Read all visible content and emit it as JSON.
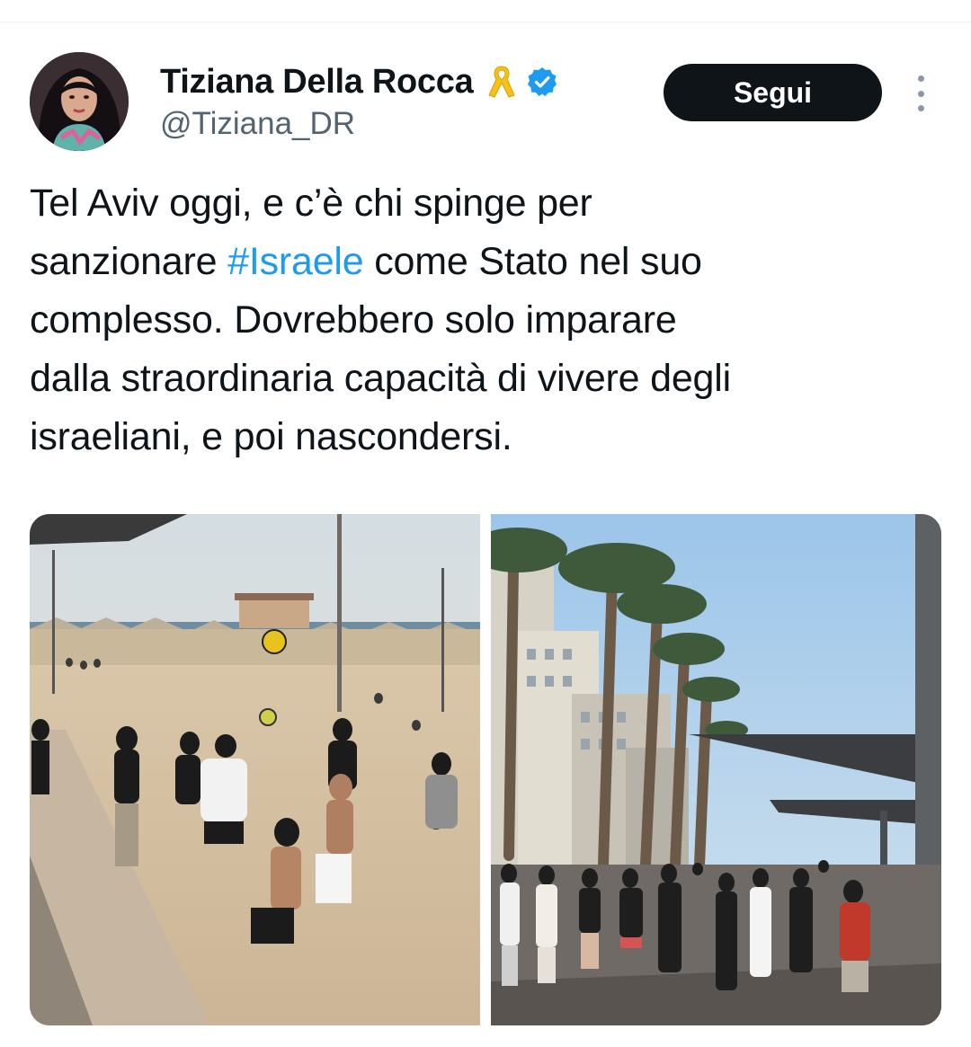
{
  "author": {
    "display_name": "Tiziana Della Rocca",
    "handle": "@Tiziana_DR",
    "badge_icon": "yellow-ribbon-icon",
    "verified_icon": "verified-badge-icon",
    "verified_color": "#1d9bf0"
  },
  "actions": {
    "follow_label": "Segui",
    "more_icon": "more-vertical-icon"
  },
  "tweet": {
    "text_line1": "Tel Aviv oggi, e c’è chi spinge per",
    "text_line2_before": "sanzionare ",
    "hashtag": "#Israele",
    "text_line2_after": " come Stato nel suo",
    "text_line3": "complesso. Dovrebbero solo imparare",
    "text_line4": "dalla straordinaria capacità di vivere degli",
    "text_line5": "israeliani, e poi nascondersi.",
    "hashtag_color": "#1d9bf0"
  },
  "media": {
    "photos": [
      "beach-football-photo",
      "promenade-crowd-photo"
    ]
  }
}
